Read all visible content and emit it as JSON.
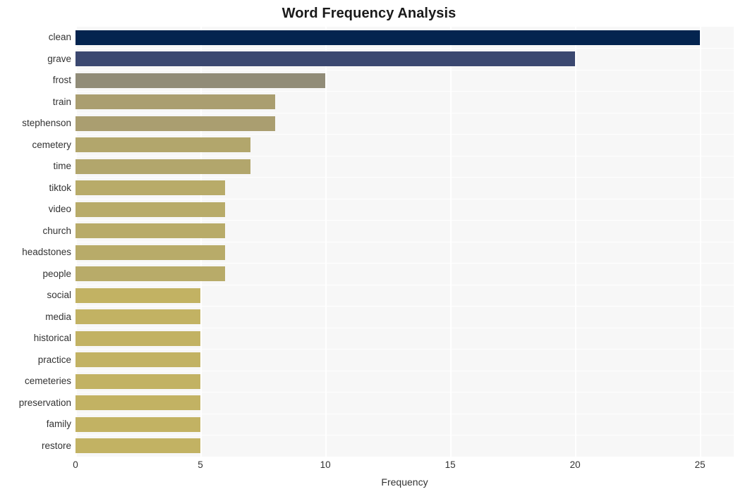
{
  "chart_data": {
    "type": "bar",
    "orientation": "horizontal",
    "title": "Word Frequency Analysis",
    "xlabel": "Frequency",
    "ylabel": "",
    "categories": [
      "clean",
      "grave",
      "frost",
      "train",
      "stephenson",
      "cemetery",
      "time",
      "tiktok",
      "video",
      "church",
      "headstones",
      "people",
      "social",
      "media",
      "historical",
      "practice",
      "cemeteries",
      "preservation",
      "family",
      "restore"
    ],
    "values": [
      25,
      20,
      10,
      8,
      8,
      7,
      7,
      6,
      6,
      6,
      6,
      6,
      5,
      5,
      5,
      5,
      5,
      5,
      5,
      5
    ],
    "bar_colors": [
      "#04244f",
      "#3b4870",
      "#918c78",
      "#aa9e70",
      "#aa9e70",
      "#b2a66c",
      "#b2a66c",
      "#b8ab69",
      "#b8ab69",
      "#b8ab69",
      "#b8ab69",
      "#b8ab69",
      "#c2b263",
      "#c2b263",
      "#c2b263",
      "#c2b263",
      "#c2b263",
      "#c2b263",
      "#c2b263",
      "#c2b263"
    ],
    "xlim": [
      0,
      26.35
    ],
    "ylim_count": 20,
    "xticks": [
      0,
      5,
      10,
      15,
      20,
      25
    ],
    "xtick_labels": [
      "0",
      "5",
      "10",
      "15",
      "20",
      "25"
    ],
    "grid": true,
    "grid_axis": "x",
    "grid_color": "#ffffff",
    "plot_background": "#f7f7f7",
    "figure_background": "#ffffff",
    "legend": false,
    "legend_position": "none",
    "title_color": "#1a1a1a",
    "tick_label_color": "#333333"
  }
}
